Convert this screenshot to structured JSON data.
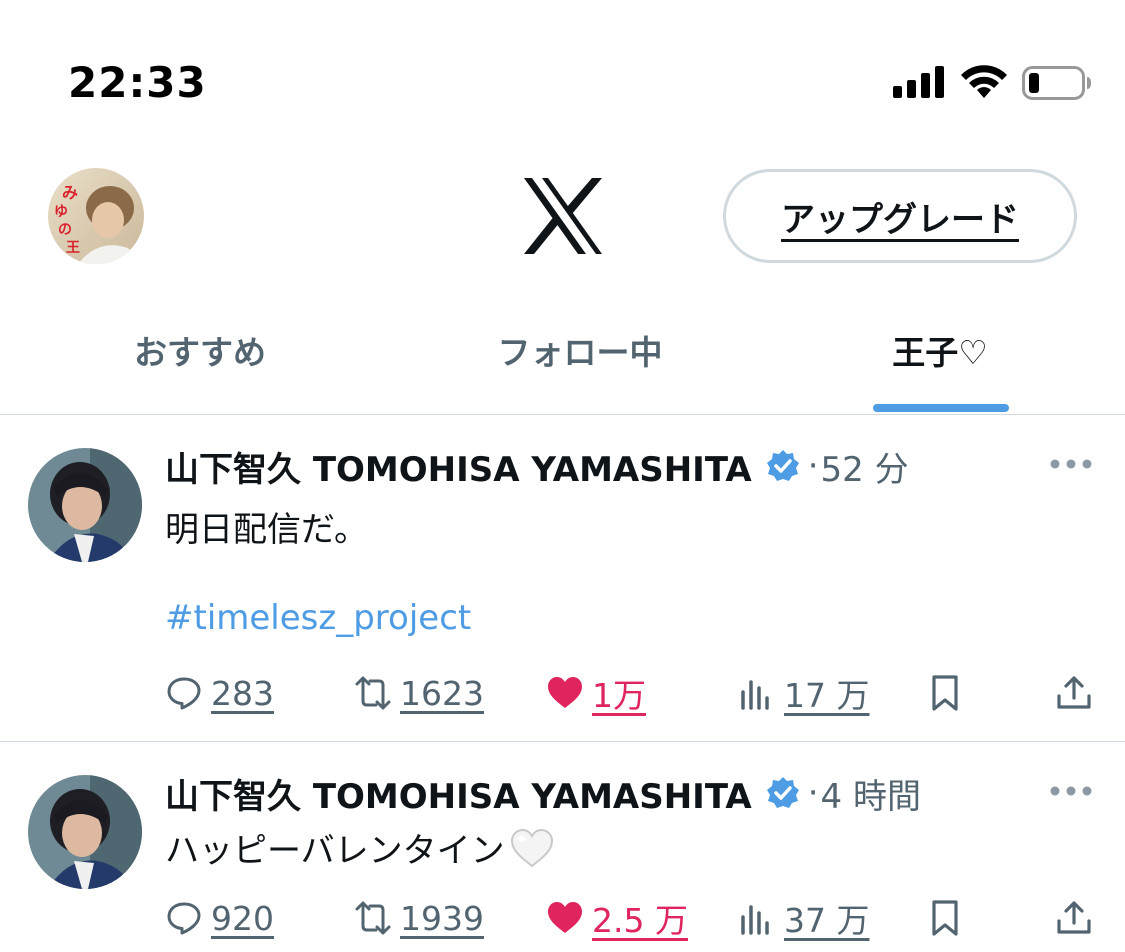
{
  "status_bar": {
    "time": "22:33"
  },
  "header": {
    "avatar_label": "みゆの王子様",
    "logo": "x-logo",
    "upgrade_label": "アップグレード"
  },
  "tabs": [
    {
      "label": "おすすめ",
      "active": false
    },
    {
      "label": "フォロー中",
      "active": false
    },
    {
      "label": "王子♡",
      "active": true
    }
  ],
  "colors": {
    "accent": "#4d9ce4",
    "like": "#e0245e",
    "secondary_text": "#536471",
    "border": "#cfd9de"
  },
  "posts": [
    {
      "display_name": "山下智久 TOMOHISA YAMASHITA",
      "verified": true,
      "separator": "·",
      "timestamp": "52 分",
      "text": "明日配信だ。",
      "hashtag": "#timelesz_project",
      "replies": "283",
      "reposts": "1623",
      "likes": "1万",
      "views": "17 万",
      "liked": true
    },
    {
      "display_name": "山下智久 TOMOHISA YAMASHITA",
      "verified": true,
      "separator": "·",
      "timestamp": "4 時間",
      "text": "ハッピーバレンタイン",
      "emoji": "white-heart",
      "replies": "920",
      "reposts": "1939",
      "likes": "2.5 万",
      "views": "37 万",
      "liked": true
    }
  ]
}
